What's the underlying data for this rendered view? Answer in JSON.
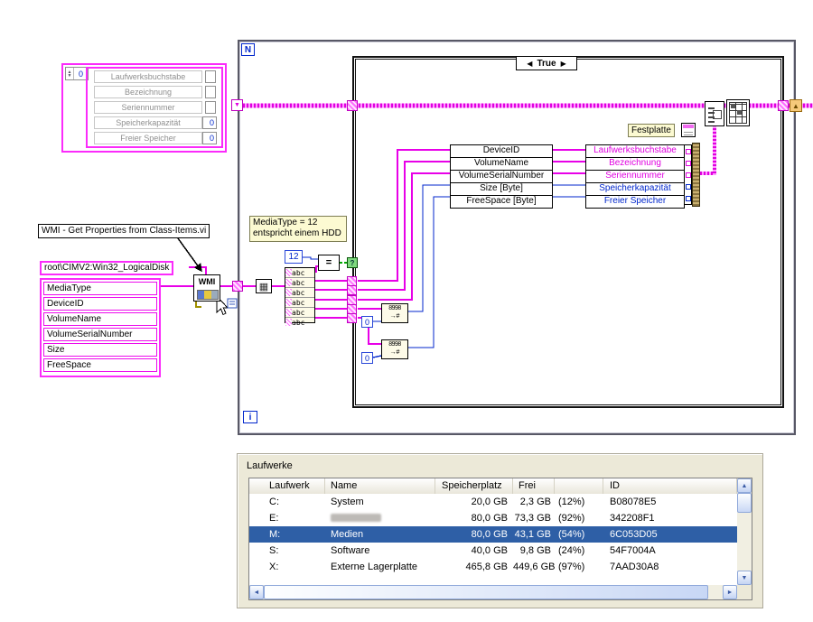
{
  "diagram": {
    "vi_name_label": "WMI - Get Properties from Class-Items.vi",
    "class_constant": "root\\CIMV2:Win32_LogicalDisk",
    "properties": [
      "MediaType",
      "DeviceID",
      "VolumeName",
      "VolumeSerialNumber",
      "Size",
      "FreeSpace"
    ],
    "array_indicator": {
      "index_value": "0",
      "fields": [
        {
          "label": "Laufwerksbuchstabe",
          "value": ""
        },
        {
          "label": "Bezeichnung",
          "value": ""
        },
        {
          "label": "Seriennummer",
          "value": ""
        },
        {
          "label": "Speicherkapazität",
          "value": "0"
        },
        {
          "label": "Freier Speicher",
          "value": "0"
        }
      ]
    },
    "wmi_icon_text": "WMI",
    "for_loop": {
      "count_terminal": "N",
      "iteration_terminal": "i"
    },
    "case_structure": {
      "selector_value": "True"
    },
    "comment_line1": "MediaType = 12",
    "comment_line2": "entspricht einem HDD",
    "constant_12": "12",
    "constant_zero_1": "0",
    "constant_zero_2": "0",
    "abc_glyph": "abc",
    "equal_glyph": "=",
    "selector_tunnel_glyph": "?",
    "scan_line1": "8998",
    "scan_line2": "→#",
    "wire_labels": [
      "DeviceID",
      "VolumeName",
      "VolumeSerialNumber",
      "Size [Byte]",
      "FreeSpace [Byte]"
    ],
    "bundle_fields": [
      {
        "label": "Laufwerksbuchstabe",
        "type": "string"
      },
      {
        "label": "Bezeichnung",
        "type": "string"
      },
      {
        "label": "Seriennummer",
        "type": "string"
      },
      {
        "label": "Speicherkapazität",
        "type": "numeric"
      },
      {
        "label": "Freier Speicher",
        "type": "numeric"
      }
    ],
    "festplatte_label": "Festplatte"
  },
  "panel": {
    "title": "Laufwerke",
    "table": {
      "columns": [
        "Laufwerk",
        "Name",
        "Speicherplatz",
        "Frei",
        "",
        "ID"
      ],
      "rows": [
        {
          "laufwerk": "C:",
          "name": "System",
          "speicherplatz": "20,0 GB",
          "frei": "2,3 GB",
          "frei_prozent": "(12%)",
          "id": "B08078E5",
          "selected": false,
          "name_redacted": false
        },
        {
          "laufwerk": "E:",
          "name": "",
          "speicherplatz": "80,0 GB",
          "frei": "73,3 GB",
          "frei_prozent": "(92%)",
          "id": "342208F1",
          "selected": false,
          "name_redacted": true
        },
        {
          "laufwerk": "M:",
          "name": "Medien",
          "speicherplatz": "80,0 GB",
          "frei": "43,1 GB",
          "frei_prozent": "(54%)",
          "id": "6C053D05",
          "selected": true,
          "name_redacted": false
        },
        {
          "laufwerk": "S:",
          "name": "Software",
          "speicherplatz": "40,0 GB",
          "frei": "9,8 GB",
          "frei_prozent": "(24%)",
          "id": "54F7004A",
          "selected": false,
          "name_redacted": false
        },
        {
          "laufwerk": "X:",
          "name": "Externe Lagerplatte",
          "speicherplatz": "465,8 GB",
          "frei": "449,6 GB",
          "frei_prozent": "(97%)",
          "id": "7AAD30A8",
          "selected": false,
          "name_redacted": false
        }
      ]
    }
  },
  "colors": {
    "string_wire": "#E800E8",
    "numeric_wire": "#0026CC",
    "boolean_wire": "#00A800",
    "selection": "#2E5FA6",
    "panel_background": "#ECE9D8",
    "label_background": "#FCFAD2"
  }
}
